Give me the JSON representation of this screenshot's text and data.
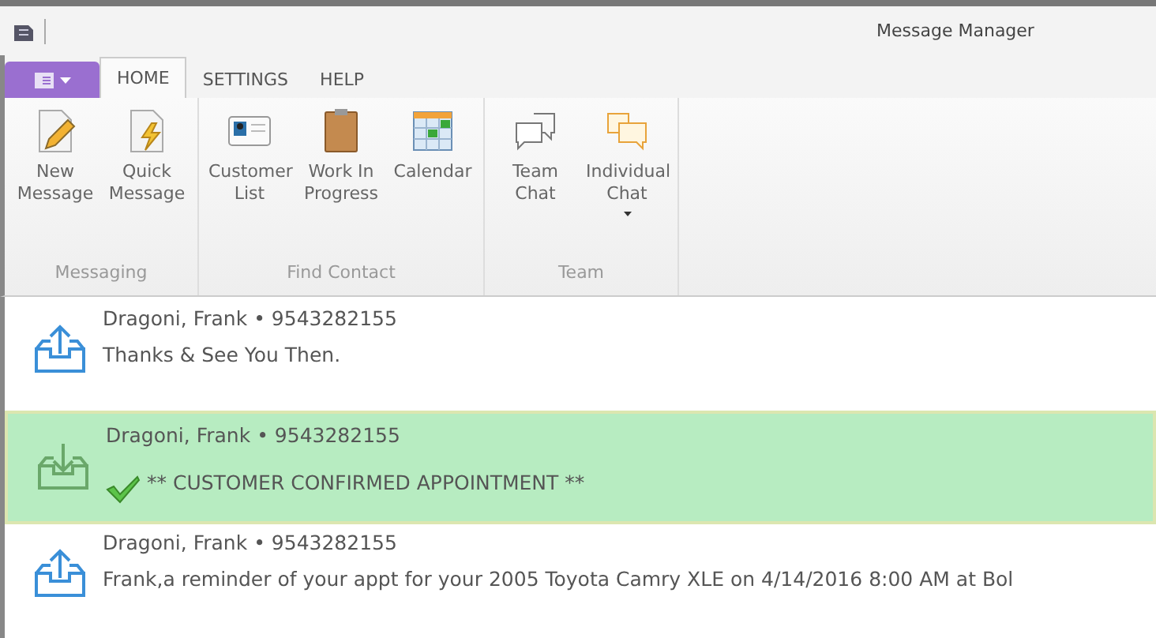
{
  "window": {
    "title": "Message Manager"
  },
  "tabs": [
    {
      "label": "HOME",
      "selected": true
    },
    {
      "label": "SETTINGS",
      "selected": false
    },
    {
      "label": "HELP",
      "selected": false
    }
  ],
  "ribbon": {
    "groups": [
      {
        "label": "Messaging",
        "buttons": [
          {
            "kind": "compose",
            "label": "New Message",
            "dropdown": false
          },
          {
            "kind": "quick",
            "label": "Quick Message",
            "dropdown": false
          }
        ]
      },
      {
        "label": "Find Contact",
        "buttons": [
          {
            "kind": "card",
            "label": "Customer List",
            "dropdown": false
          },
          {
            "kind": "clipboard",
            "label": "Work In Progress",
            "dropdown": false
          },
          {
            "kind": "calendar",
            "label": "Calendar",
            "dropdown": false
          }
        ]
      },
      {
        "label": "Team",
        "buttons": [
          {
            "kind": "chat",
            "label": "Team Chat",
            "dropdown": false
          },
          {
            "kind": "chatorange",
            "label": "Individual Chat",
            "dropdown": true
          }
        ]
      }
    ]
  },
  "messages": [
    {
      "kind": "outgoing",
      "selected": false,
      "confirmed": false,
      "sender": "Dragoni, Frank • 9543282155",
      "text": "Thanks & See You Then."
    },
    {
      "kind": "incoming",
      "selected": true,
      "confirmed": true,
      "sender": "Dragoni, Frank • 9543282155",
      "text": "** CUSTOMER CONFIRMED APPOINTMENT **"
    },
    {
      "kind": "outgoing",
      "selected": false,
      "confirmed": false,
      "sender": "Dragoni, Frank • 9543282155",
      "text": "Frank,a reminder of your appt for your 2005 Toyota Camry XLE on 4/14/2016 8:00 AM at Bol"
    }
  ]
}
